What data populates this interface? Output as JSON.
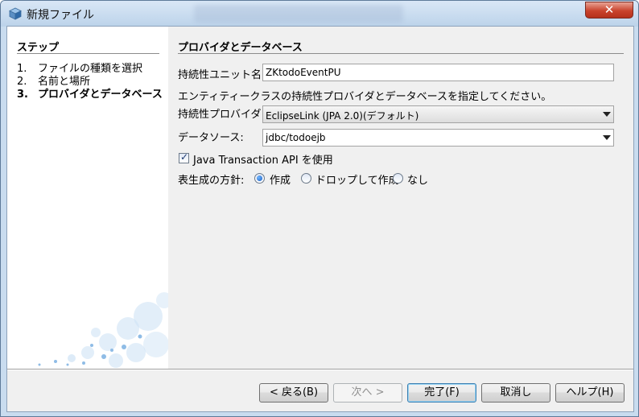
{
  "window": {
    "title": "新規ファイル",
    "close_symbol": "✕"
  },
  "steps": {
    "header": "ステップ",
    "items": [
      {
        "num": "1.",
        "label": "ファイルの種類を選択"
      },
      {
        "num": "2.",
        "label": "名前と場所"
      },
      {
        "num": "3.",
        "label": "プロバイダとデータベース"
      }
    ]
  },
  "panel": {
    "title": "プロバイダとデータベース",
    "unit_label": "持続性ユニット名:",
    "unit_value": "ZKtodoEventPU",
    "description": "エンティティークラスの持続性プロバイダとデータベースを指定してください。",
    "provider_label": "持続性プロバイダ:",
    "provider_value": "EclipseLink (JPA 2.0)(デフォルト)",
    "datasource_label": "データソース:",
    "datasource_value": "jdbc/todoejb",
    "jta_label": "Java Transaction API を使用",
    "jta_checked": true,
    "table_strategy_label": "表生成の方針:",
    "strategies": [
      {
        "label": "作成",
        "selected": true
      },
      {
        "label": "ドロップして作成",
        "selected": false
      },
      {
        "label": "なし",
        "selected": false
      }
    ]
  },
  "buttons": {
    "back": "< 戻る(B)",
    "next": "次へ >",
    "finish": "完了(F)",
    "cancel": "取消し",
    "help": "ヘルプ(H)"
  },
  "icons": {
    "title": "netbeans-cube-icon",
    "checkbox": "check-mark-icon",
    "combo": "dropdown-arrow-icon"
  }
}
